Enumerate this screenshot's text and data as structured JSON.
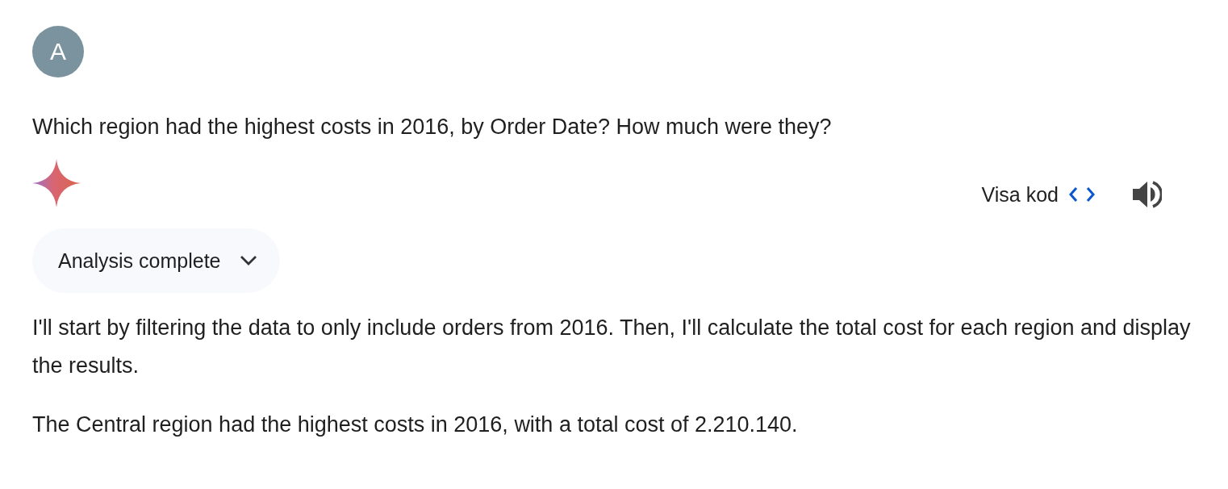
{
  "user": {
    "avatar_letter": "A"
  },
  "question": "Which region had the highest costs in 2016, by Order Date? How much were they?",
  "response": {
    "actions": {
      "show_code": "Visa kod"
    },
    "analysis": {
      "label": "Analysis complete",
      "expanded": false
    },
    "paragraphs": [
      "I'll start by filtering the data to only include orders from 2016. Then, I'll calculate the total cost for each region and display the results.",
      "The Central region had the highest costs in 2016, with a total cost of 2.210.140."
    ]
  }
}
